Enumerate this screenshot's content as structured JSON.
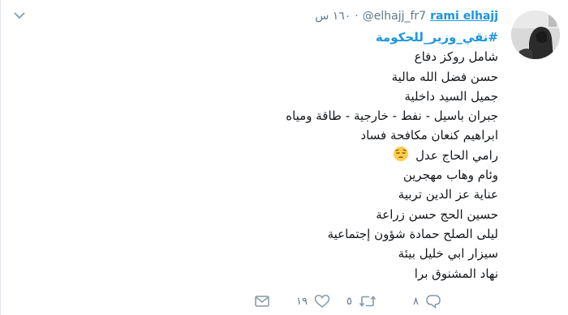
{
  "author": {
    "name": "rami elhajj",
    "handle": "@elhajj_fr7",
    "separator": "·",
    "time": "١٦٠ س"
  },
  "tweet": {
    "hashtag": "#نقي_وزير_للحكومة",
    "lines": [
      "شامل روكز دفاع",
      "حسن فضل الله مالية",
      "جميل السيد داخلية",
      "جبران باسيل - نفط - خارجية - طاقة ومياه",
      "ابراهيم كنعان مكافحة فساد",
      "رامي الحاج عدل",
      "وئام وهاب مهجرين",
      "عناية عز الدين تربية",
      "حسين الحج حسن زراعة",
      "ليلى الصلح حمادة شؤون إجتماعية",
      "سيزار ابي خليل بيئة",
      "نهاد المشنوق برا"
    ],
    "emoji_name": "pensive-face-emoji"
  },
  "actions": {
    "reply_count": "",
    "retweet_count": "١٩",
    "like_count": "٥",
    "dm_count": "٨"
  },
  "colors": {
    "link": "#1b95e0",
    "muted": "#657786",
    "text": "#14171a"
  }
}
